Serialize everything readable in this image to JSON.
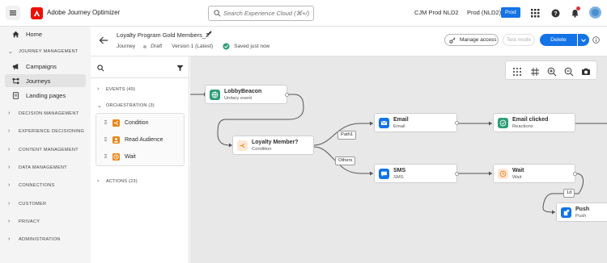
{
  "topbar": {
    "app_title": "Adobe Journey Optimizer",
    "search_placeholder": "Search Experience Cloud (⌘+/)",
    "org": "CJM Prod NLD2",
    "sandbox": "Prod (NLD2)",
    "sandbox_badge": "Prod"
  },
  "leftnav": {
    "items": [
      {
        "label": "Home",
        "icon": "home-icon"
      },
      {
        "label": "Campaigns",
        "icon": "megaphone-icon"
      },
      {
        "label": "Journeys",
        "icon": "journey-icon"
      },
      {
        "label": "Landing pages",
        "icon": "page-icon"
      }
    ],
    "sections": [
      "JOURNEY MANAGEMENT",
      "DECISION MANAGEMENT",
      "EXPERIENCE DECISIONING",
      "CONTENT MANAGEMENT",
      "DATA MANAGEMENT",
      "CONNECTIONS",
      "CUSTOMER",
      "PRIVACY",
      "ADMINISTRATION"
    ]
  },
  "journey": {
    "title": "Loyalty Program Gold Members_2",
    "type": "Journey",
    "status": "Draft",
    "version": "Version 1 (Latest)",
    "saved": "Saved just now",
    "manage_access": "Manage access",
    "test_mode": "Test mode",
    "delete": "Delete"
  },
  "palette": {
    "events": "EVENTS (49)",
    "orchestration": "ORCHESTRATION (3)",
    "orch_items": [
      "Condition",
      "Read Audience",
      "Wait"
    ],
    "actions": "ACTIONS (23)"
  },
  "canvas": {
    "nodes": {
      "lobby": {
        "title": "LobbyBeacon",
        "sub": "Unitary event"
      },
      "loyalty": {
        "title": "Loyalty Member?",
        "sub": "Condition"
      },
      "email": {
        "title": "Email",
        "sub": "Email"
      },
      "email_clicked": {
        "title": "Email clicked",
        "sub": "Reactions"
      },
      "sms": {
        "title": "SMS",
        "sub": "SMS"
      },
      "wait": {
        "title": "Wait",
        "sub": "Wait"
      },
      "push": {
        "title": "Push",
        "sub": "Push"
      }
    },
    "labels": {
      "path1": "Path1",
      "others": "Others",
      "wait_duration": "1d"
    }
  },
  "colors": {
    "accent": "#1473e6",
    "brand": "#eb1000",
    "event_icon": "#2d9d78",
    "condition_icon": "#e68619",
    "message_icon": "#1473e6",
    "saved_check": "#2d9d78"
  }
}
